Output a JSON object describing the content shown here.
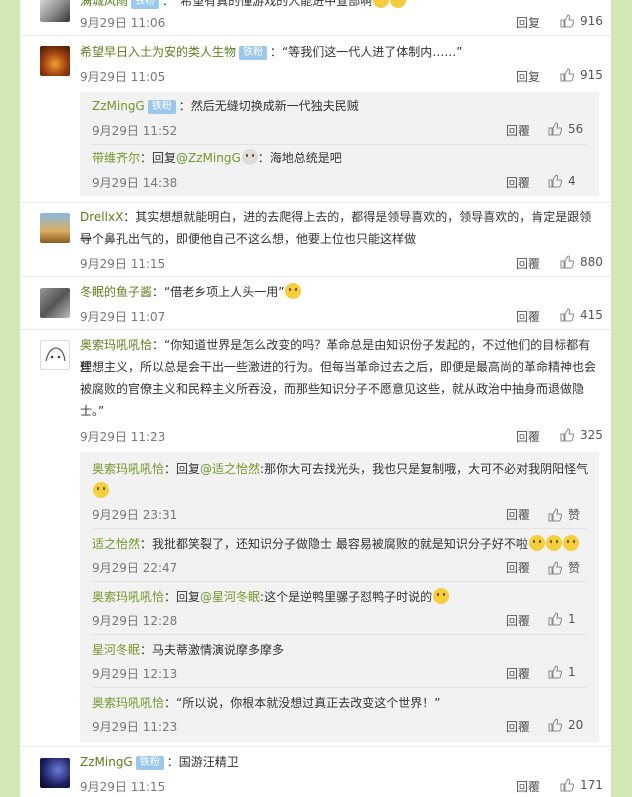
{
  "comments": [
    {
      "id": "c0",
      "name": "满城风雨",
      "badge": "铁粉",
      "text": "：“希望有真的懂游戏的人能进中宣部啊",
      "time": "9月29日 11:06",
      "reply": "回复",
      "likes": "916"
    },
    {
      "id": "c1",
      "name": "希望早日入土为安的类人生物",
      "badge": "铁粉",
      "text": "：“等我们这一代人进了体制内……”",
      "time": "9月29日 11:05",
      "reply": "回复",
      "likes": "915",
      "subs": [
        {
          "name": "ZzMingG",
          "badge": "铁粉",
          "text": "：然后无缝切换成新一代独夫民贼",
          "time": "9月29日 11:52",
          "reply": "回覆",
          "likes": "56"
        },
        {
          "name": "带维齐尔",
          "text_pre": "：回复",
          "mention": "@ZzMingG",
          "text": "：海地总统是吧",
          "time": "9月29日 14:38",
          "reply": "回覆",
          "likes": "4"
        }
      ]
    },
    {
      "id": "c2",
      "name": "DrellxX",
      "text1": "：其实想想就能明白，进的去爬得上去的，都得是领导喜欢的，领导喜欢的，肯定是跟领导",
      "text2": "一个鼻孔出气的，即便他自己不这么想，他要上位也只能这样做",
      "time": "9月29日 11:15",
      "reply": "回覆",
      "likes": "880"
    },
    {
      "id": "c3",
      "name": "冬眠的鱼子酱",
      "text": "：“借老乡项上人头一用”",
      "time": "9月29日 11:07",
      "reply": "回覆",
      "likes": "415"
    },
    {
      "id": "c4",
      "name": "奥索玛吼吼恰",
      "text1": "：“你知道世界是怎么改变的吗？革命总是由知识份子发起的，不过他们的目标都有些",
      "text2": "理想主义，所以总是会干出一些激进的行为。但每当革命过去之后，即便是最高尚的革命精神也会",
      "text3": "被腐败的官僚主义和民粹主义所吞没，而那些知识分子不愿意见这些，就从政治中抽身而退做隐",
      "text4": "士。”",
      "time": "9月29日 11:23",
      "reply": "回覆",
      "likes": "325",
      "subs": [
        {
          "name": "奥索玛吼吼恰",
          "text_pre": "：回复",
          "mention": "@适之怡然",
          "text": ":那你大可去找光头，我也只是复制哦，大可不必对我阴阳怪气",
          "time": "9月29日 23:31",
          "reply": "回覆",
          "likes": "赞"
        },
        {
          "name": "适之怡然",
          "text": "：我批都笑裂了，还知识分子做隐士 最容易被腐败的就是知识分子好不啦",
          "time": "9月29日 22:47",
          "reply": "回覆",
          "likes": "赞"
        },
        {
          "name": "奥索玛吼吼恰",
          "text_pre": "：回复",
          "mention": "@星河冬眠",
          "text": ":这个是逆鸭里骡子怼鸭子时说的",
          "time": "9月29日 12:28",
          "reply": "回覆",
          "likes": "1"
        },
        {
          "name": "星河冬眠",
          "text": "：马夫蒂激情演说摩多摩多",
          "time": "9月29日 12:13",
          "reply": "回覆",
          "likes": "1"
        },
        {
          "name": "奥索玛吼吼恰",
          "text": "：“所以说，你根本就没想过真正去改变这个世界！”",
          "time": "9月29日 11:23",
          "reply": "回覆",
          "likes": "20"
        }
      ]
    },
    {
      "id": "c5",
      "name": "ZzMingG",
      "badge": "铁粉",
      "text": "：国游汪精卫",
      "time": "9月29日 11:15",
      "reply": "回覆",
      "likes": "171"
    }
  ],
  "colors": {
    "page_bg": "#d1e7b4",
    "name": "#5c7f1a",
    "badge": "#9ac7ec"
  }
}
